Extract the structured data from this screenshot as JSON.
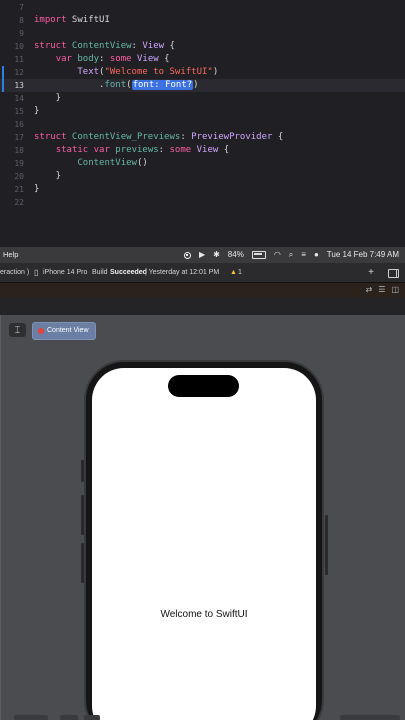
{
  "editor": {
    "lines": [
      {
        "num": "7",
        "tokens": []
      },
      {
        "num": "8",
        "tokens": [
          {
            "t": "import",
            "c": "kw"
          },
          {
            "t": " SwiftUI",
            "c": ""
          }
        ]
      },
      {
        "num": "9",
        "tokens": []
      },
      {
        "num": "10",
        "tokens": [
          {
            "t": "struct",
            "c": "kw"
          },
          {
            "t": " ContentView",
            "c": "ty2"
          },
          {
            "t": ": ",
            "c": ""
          },
          {
            "t": "View",
            "c": "typ"
          },
          {
            "t": " {",
            "c": ""
          }
        ]
      },
      {
        "num": "11",
        "tokens": [
          {
            "t": "    ",
            "c": ""
          },
          {
            "t": "var",
            "c": "kw"
          },
          {
            "t": " body",
            "c": "fn"
          },
          {
            "t": ": ",
            "c": ""
          },
          {
            "t": "some",
            "c": "kw"
          },
          {
            "t": " ",
            "c": ""
          },
          {
            "t": "View",
            "c": "typ"
          },
          {
            "t": " {",
            "c": ""
          }
        ]
      },
      {
        "num": "12",
        "tokens": [
          {
            "t": "        ",
            "c": ""
          },
          {
            "t": "Text",
            "c": "typ"
          },
          {
            "t": "(",
            "c": ""
          },
          {
            "t": "\"Welcome to SwiftUI\"",
            "c": "str"
          },
          {
            "t": ")",
            "c": ""
          }
        ]
      },
      {
        "num": "13",
        "tokens": [
          {
            "t": "            .",
            "c": ""
          },
          {
            "t": "font",
            "c": "fn"
          },
          {
            "t": "(",
            "c": ""
          },
          {
            "t": "font: Font?",
            "c": "ph"
          },
          {
            "t": ")",
            "c": ""
          }
        ]
      },
      {
        "num": "14",
        "tokens": [
          {
            "t": "    }",
            "c": ""
          }
        ]
      },
      {
        "num": "15",
        "tokens": [
          {
            "t": "}",
            "c": ""
          }
        ]
      },
      {
        "num": "16",
        "tokens": []
      },
      {
        "num": "17",
        "tokens": [
          {
            "t": "struct",
            "c": "kw"
          },
          {
            "t": " ContentView_Previews",
            "c": "ty2"
          },
          {
            "t": ": ",
            "c": ""
          },
          {
            "t": "PreviewProvider",
            "c": "typ"
          },
          {
            "t": " {",
            "c": ""
          }
        ]
      },
      {
        "num": "18",
        "tokens": [
          {
            "t": "    ",
            "c": ""
          },
          {
            "t": "static",
            "c": "kw"
          },
          {
            "t": " ",
            "c": ""
          },
          {
            "t": "var",
            "c": "kw"
          },
          {
            "t": " previews",
            "c": "fn"
          },
          {
            "t": ": ",
            "c": ""
          },
          {
            "t": "some",
            "c": "kw"
          },
          {
            "t": " ",
            "c": ""
          },
          {
            "t": "View",
            "c": "typ"
          },
          {
            "t": " {",
            "c": ""
          }
        ]
      },
      {
        "num": "19",
        "tokens": [
          {
            "t": "        ",
            "c": ""
          },
          {
            "t": "ContentView",
            "c": "ty2"
          },
          {
            "t": "()",
            "c": ""
          }
        ]
      },
      {
        "num": "20",
        "tokens": [
          {
            "t": "    }",
            "c": ""
          }
        ]
      },
      {
        "num": "21",
        "tokens": [
          {
            "t": "}",
            "c": ""
          }
        ]
      },
      {
        "num": "22",
        "tokens": []
      }
    ],
    "current_line": "13"
  },
  "menubar": {
    "help": "Help",
    "battery": "84%",
    "datetime": "Tue 14 Feb  7:49 AM"
  },
  "toolbar": {
    "scheme": "eraction )",
    "device_icon": "phone-icon",
    "device": "iPhone 14 Pro",
    "build_prefix": "Build",
    "build_status": "Succeeded",
    "build_time": "| Yesterday at 12:01 PM",
    "warning_count": "1",
    "add": "+"
  },
  "canvas": {
    "pin_icon": "pin-icon",
    "content_view_label": "Content View",
    "preview_text": "Welcome to SwiftUI"
  },
  "colors": {
    "editor_bg": "#1f1f24",
    "keyword": "#fc5fa3",
    "string": "#fc6a5d",
    "placeholder": "#3b72e0",
    "canvas_bg": "#4a4c4f"
  }
}
